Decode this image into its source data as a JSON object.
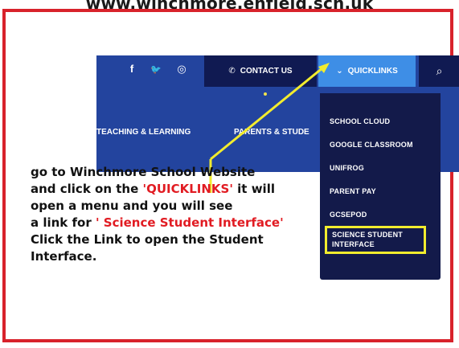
{
  "header_url": "www.winchmore.enfield.sch.uk",
  "site": {
    "social": [
      "f",
      "🐦",
      "◎"
    ],
    "contact_label": "CONTACT US",
    "quicklinks_label": "QUICKLINKS",
    "nav": [
      "TEACHING & LEARNING",
      "PARENTS & STUDE"
    ]
  },
  "menu": {
    "items": [
      "SCHOOL CLOUD",
      "GOOGLE CLASSROOM",
      "UNIFROG",
      "PARENT PAY",
      "GCSEPOD"
    ],
    "highlighted_item": "SCIENCE STUDENT INTERFACE"
  },
  "instructions": {
    "line1": "go to Winchmore School Website",
    "line2_pre": "and click on the ",
    "line2_red": "'QUICKLINKS'",
    "line2_post": " it will",
    "line3": "open a menu and you will see",
    "line4_pre": "a link for ",
    "line4_red": "' Science Student Interface'",
    "line5": "Click the Link to open the Student",
    "line6": "Interface."
  },
  "colors": {
    "frame": "#d8222b",
    "site_blue": "#23449e",
    "quicklinks_blue": "#3e8ee6",
    "menu_navy": "#131a4a",
    "highlight_yellow": "#f2ec2e",
    "instruction_red": "#e11b22"
  }
}
